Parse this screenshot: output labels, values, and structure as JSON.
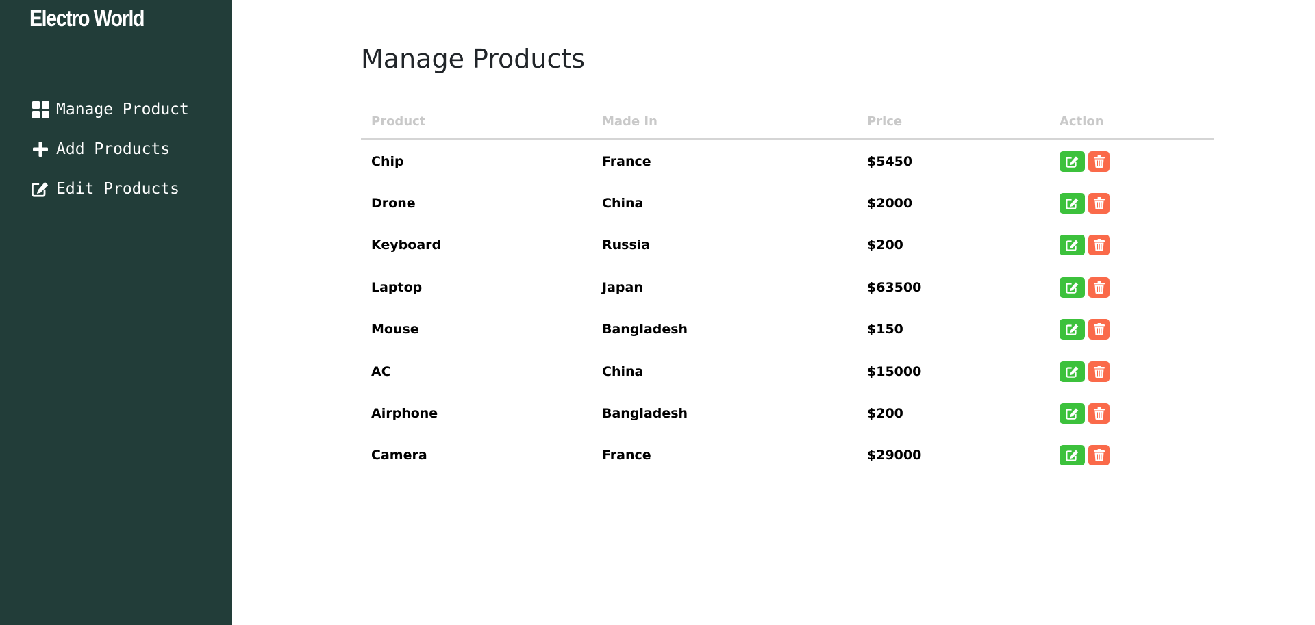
{
  "app": {
    "brand": "Electro World"
  },
  "sidebar": {
    "items": [
      {
        "label": "Manage Product",
        "icon": "grid-icon"
      },
      {
        "label": "Add Products",
        "icon": "plus-icon"
      },
      {
        "label": "Edit Products",
        "icon": "edit-icon"
      }
    ]
  },
  "main": {
    "title": "Manage Products",
    "table": {
      "headers": [
        "Product",
        "Made In",
        "Price",
        "Action"
      ],
      "rows": [
        {
          "product": "Chip",
          "made_in": "France",
          "price": "$5450"
        },
        {
          "product": "Drone",
          "made_in": "China",
          "price": "$2000"
        },
        {
          "product": "Keyboard",
          "made_in": "Russia",
          "price": "$200"
        },
        {
          "product": "Laptop",
          "made_in": "Japan",
          "price": "$63500"
        },
        {
          "product": "Mouse",
          "made_in": "Bangladesh",
          "price": "$150"
        },
        {
          "product": "AC",
          "made_in": "China",
          "price": "$15000"
        },
        {
          "product": "Airphone",
          "made_in": "Bangladesh",
          "price": "$200"
        },
        {
          "product": "Camera",
          "made_in": "France",
          "price": "$29000"
        }
      ],
      "actions": {
        "edit_icon": "edit-icon",
        "delete_icon": "trash-icon"
      }
    }
  },
  "colors": {
    "sidebar_bg": "#223d39",
    "edit_button": "#3cc13c",
    "delete_button": "#fa6a4a",
    "header_text": "#c9c9c9"
  }
}
